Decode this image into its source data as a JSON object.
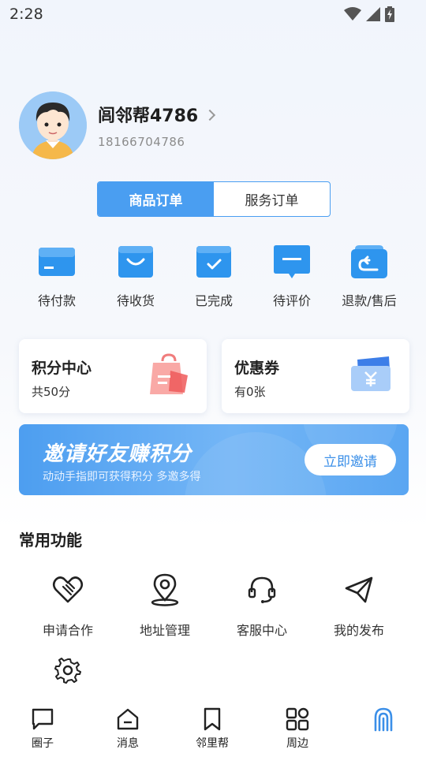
{
  "status_bar": {
    "time": "2:28"
  },
  "profile": {
    "username": "闾邻帮4786",
    "phone": "18166704786"
  },
  "order_tabs": [
    {
      "label": "商品订单",
      "active": true
    },
    {
      "label": "服务订单",
      "active": false
    }
  ],
  "order_status": [
    {
      "label": "待付款",
      "icon": "card-icon"
    },
    {
      "label": "待收货",
      "icon": "bag-icon"
    },
    {
      "label": "已完成",
      "icon": "check-box-icon"
    },
    {
      "label": "待评价",
      "icon": "comment-icon"
    },
    {
      "label": "退款/售后",
      "icon": "return-icon"
    }
  ],
  "cards": {
    "points": {
      "title": "积分中心",
      "sub": "共50分"
    },
    "coupon": {
      "title": "优惠券",
      "sub": "有0张"
    }
  },
  "banner": {
    "title": "邀请好友赚积分",
    "sub": "动动手指即可获得积分 多邀多得",
    "button": "立即邀请"
  },
  "common": {
    "title": "常用功能",
    "items": [
      {
        "label": "申请合作",
        "icon": "handshake-heart-icon"
      },
      {
        "label": "地址管理",
        "icon": "location-pin-icon"
      },
      {
        "label": "客服中心",
        "icon": "headset-icon"
      },
      {
        "label": "我的发布",
        "icon": "paper-plane-icon"
      }
    ],
    "extra_icon": "gear-icon"
  },
  "bottom_nav": [
    {
      "label": "圈子",
      "icon": "chat-icon"
    },
    {
      "label": "消息",
      "icon": "home-icon"
    },
    {
      "label": "邻里帮",
      "icon": "bookmark-icon"
    },
    {
      "label": "周边",
      "icon": "grid-icon"
    },
    {
      "label": "",
      "icon": "fingerprint-icon"
    }
  ],
  "colors": {
    "accent": "#4a9ef1",
    "banner_start": "#4d9ef0",
    "banner_end": "#74b6f6",
    "icon_blue": "#2e95ee"
  }
}
